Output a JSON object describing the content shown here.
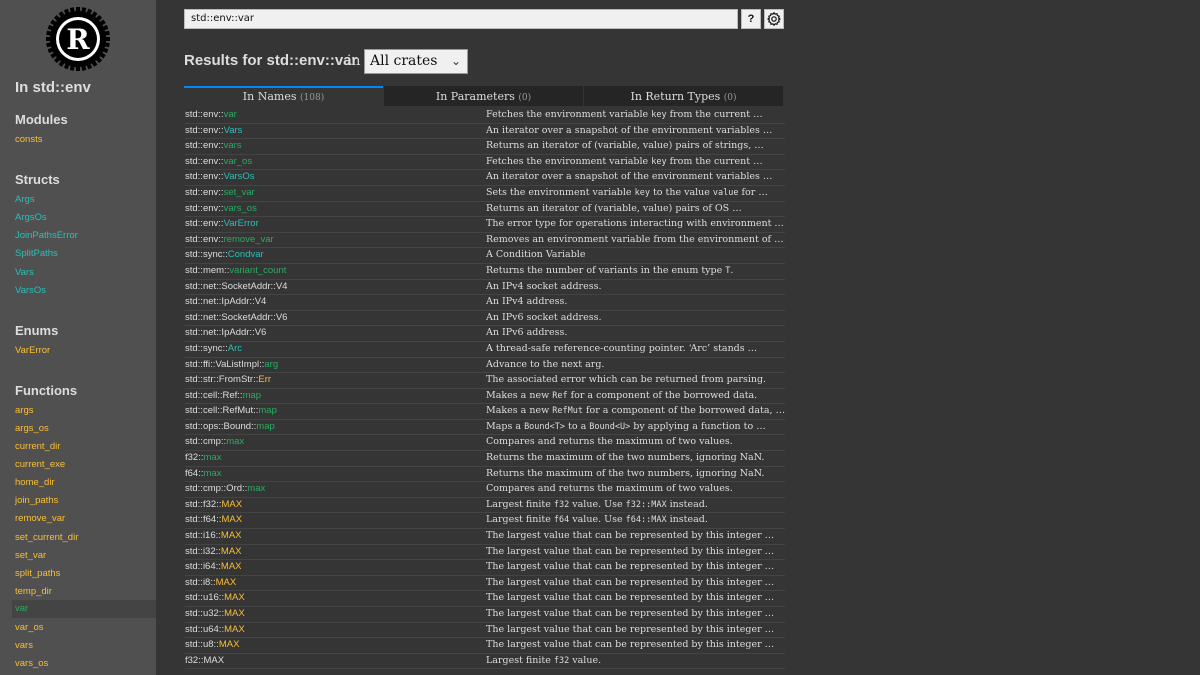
{
  "sidebar": {
    "crate_title": "In std::env",
    "sections": [
      {
        "title": "Modules",
        "kind": "mod",
        "items": [
          "consts"
        ]
      },
      {
        "title": "Structs",
        "kind": "struct",
        "items": [
          "Args",
          "ArgsOs",
          "JoinPathsError",
          "SplitPaths",
          "Vars",
          "VarsOs"
        ]
      },
      {
        "title": "Enums",
        "kind": "enum",
        "items": [
          "VarError"
        ]
      },
      {
        "title": "Functions",
        "kind": "fn",
        "items": [
          "args",
          "args_os",
          "current_dir",
          "current_exe",
          "home_dir",
          "join_paths",
          "remove_var",
          "set_current_dir",
          "set_var",
          "split_paths",
          "temp_dir",
          "var",
          "var_os",
          "vars",
          "vars_os"
        ]
      }
    ],
    "current": "var"
  },
  "search": {
    "value": "std::env::var",
    "help_label": "?"
  },
  "results": {
    "title": "Results for std::env::var",
    "in_label": "in",
    "crate_filter": "All crates"
  },
  "tabs": [
    {
      "label": "In Names",
      "count": "(108)"
    },
    {
      "label": "In Parameters",
      "count": "(0)"
    },
    {
      "label": "In Return Types",
      "count": "(0)"
    }
  ],
  "rows": [
    {
      "prefix": "std::env::",
      "name": "var",
      "kind": "fn",
      "desc": "Fetches the environment variable <code>key</code> from the current …"
    },
    {
      "prefix": "std::env::",
      "name": "Vars",
      "kind": "struct",
      "desc": "An iterator over a snapshot of the environment variables …"
    },
    {
      "prefix": "std::env::",
      "name": "vars",
      "kind": "fn",
      "desc": "Returns an iterator of (variable, value) pairs of strings, …"
    },
    {
      "prefix": "std::env::",
      "name": "var_os",
      "kind": "fn",
      "desc": "Fetches the environment variable <code>key</code> from the current …"
    },
    {
      "prefix": "std::env::",
      "name": "VarsOs",
      "kind": "struct",
      "desc": "An iterator over a snapshot of the environment variables …"
    },
    {
      "prefix": "std::env::",
      "name": "set_var",
      "kind": "fn",
      "desc": "Sets the environment variable <code>key</code> to the value <code>value</code> for …"
    },
    {
      "prefix": "std::env::",
      "name": "vars_os",
      "kind": "fn",
      "desc": "Returns an iterator of (variable, value) pairs of OS …"
    },
    {
      "prefix": "std::env::",
      "name": "VarError",
      "kind": "struct",
      "desc": "The error type for operations interacting with environment …"
    },
    {
      "prefix": "std::env::",
      "name": "remove_var",
      "kind": "fn",
      "desc": "Removes an environment variable from the environment of …"
    },
    {
      "prefix": "std::sync::",
      "name": "Condvar",
      "kind": "struct",
      "desc": "A Condition Variable"
    },
    {
      "prefix": "std::mem::",
      "name": "variant_count",
      "kind": "fn",
      "desc": "Returns the number of variants in the enum type <code>T</code>."
    },
    {
      "prefix": "std::net::SocketAddr::V4",
      "name": "",
      "kind": "plain",
      "desc": "An IPv4 socket address."
    },
    {
      "prefix": "std::net::IpAddr::V4",
      "name": "",
      "kind": "plain",
      "desc": "An IPv4 address."
    },
    {
      "prefix": "std::net::SocketAddr::V6",
      "name": "",
      "kind": "plain",
      "desc": "An IPv6 socket address."
    },
    {
      "prefix": "std::net::IpAddr::V6",
      "name": "",
      "kind": "plain",
      "desc": "An IPv6 address."
    },
    {
      "prefix": "std::sync::",
      "name": "Arc",
      "kind": "struct",
      "desc": "A thread-safe reference-counting pointer. ‘Arc’ stands …"
    },
    {
      "prefix": "std::ffi::VaListImpl::",
      "name": "arg",
      "kind": "fn",
      "desc": "Advance to the next arg."
    },
    {
      "prefix": "std::str::FromStr::",
      "name": "Err",
      "kind": "type",
      "desc": "The associated error which can be returned from parsing."
    },
    {
      "prefix": "std::cell::Ref::",
      "name": "map",
      "kind": "fn",
      "desc": "Makes a new <code>Ref</code> for a component of the borrowed data."
    },
    {
      "prefix": "std::cell::RefMut::",
      "name": "map",
      "kind": "fn",
      "desc": "Makes a new <code>RefMut</code> for a component of the borrowed data, …"
    },
    {
      "prefix": "std::ops::Bound::",
      "name": "map",
      "kind": "fn",
      "desc": "Maps a <code>Bound&lt;T&gt;</code> to a <code>Bound&lt;U&gt;</code> by applying a function to …"
    },
    {
      "prefix": "std::cmp::",
      "name": "max",
      "kind": "fn",
      "desc": "Compares and returns the maximum of two values."
    },
    {
      "prefix": "f32::",
      "name": "max",
      "kind": "fn",
      "desc": "Returns the maximum of the two numbers, ignoring NaN."
    },
    {
      "prefix": "f64::",
      "name": "max",
      "kind": "fn",
      "desc": "Returns the maximum of the two numbers, ignoring NaN."
    },
    {
      "prefix": "std::cmp::Ord::",
      "name": "max",
      "kind": "fn",
      "desc": "Compares and returns the maximum of two values."
    },
    {
      "prefix": "std::f32::",
      "name": "MAX",
      "kind": "type",
      "desc": "Largest finite <code>f32</code> value. Use <code>f32::MAX</code> instead."
    },
    {
      "prefix": "std::f64::",
      "name": "MAX",
      "kind": "type",
      "desc": "Largest finite <code>f64</code> value. Use <code>f64::MAX</code> instead."
    },
    {
      "prefix": "std::i16::",
      "name": "MAX",
      "kind": "type",
      "desc": "The largest value that can be represented by this integer …"
    },
    {
      "prefix": "std::i32::",
      "name": "MAX",
      "kind": "type",
      "desc": "The largest value that can be represented by this integer …"
    },
    {
      "prefix": "std::i64::",
      "name": "MAX",
      "kind": "type",
      "desc": "The largest value that can be represented by this integer …"
    },
    {
      "prefix": "std::i8::",
      "name": "MAX",
      "kind": "type",
      "desc": "The largest value that can be represented by this integer …"
    },
    {
      "prefix": "std::u16::",
      "name": "MAX",
      "kind": "type",
      "desc": "The largest value that can be represented by this integer …"
    },
    {
      "prefix": "std::u32::",
      "name": "MAX",
      "kind": "type",
      "desc": "The largest value that can be represented by this integer …"
    },
    {
      "prefix": "std::u64::",
      "name": "MAX",
      "kind": "type",
      "desc": "The largest value that can be represented by this integer …"
    },
    {
      "prefix": "std::u8::",
      "name": "MAX",
      "kind": "type",
      "desc": "The largest value that can be represented by this integer …"
    },
    {
      "prefix": "f32::MAX",
      "name": "",
      "kind": "plain",
      "desc": "Largest finite <code>f32</code> value."
    }
  ],
  "colors": {
    "sidebar_bg": "#505050",
    "main_bg": "#353535",
    "fn": "#2bab63",
    "struct": "#2dbfb8",
    "type_const": "#fdbf35",
    "tab_active_border": "#0089ff"
  },
  "icons": {
    "logo": "rust-logo",
    "settings": "gear-icon",
    "select": "chevron-down-icon"
  }
}
